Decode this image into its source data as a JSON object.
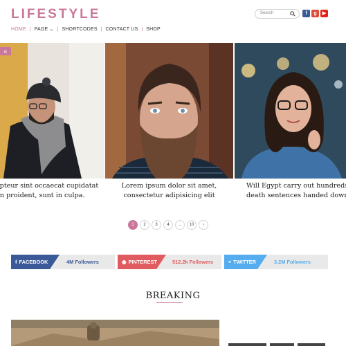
{
  "header": {
    "logo": "LIFESTYLE",
    "search_placeholder": "Search",
    "social_icons": [
      "facebook-icon",
      "google-plus-icon",
      "youtube-icon"
    ],
    "social_glyphs": [
      "f",
      "g",
      "▶"
    ]
  },
  "nav": {
    "items": [
      "HOME",
      "PAGE",
      "SHORTCODES",
      "CONTACT US",
      "SHOP"
    ]
  },
  "slider": {
    "prev_arrow": "«",
    "cards": [
      {
        "line1": "epteur sint occaecat cupidatat",
        "line2": "on proident, sunt in culpa."
      },
      {
        "line1": "Lorem ipsum dolor sit amet,",
        "line2": "consectetur adipisicing elit"
      },
      {
        "line1": "Will Egypt carry out hundreds o",
        "line2": "death sentences handed down?"
      }
    ]
  },
  "pagination": {
    "pages": [
      "1",
      "2",
      "3",
      "4",
      "...",
      "10",
      "›"
    ],
    "active": "1"
  },
  "social_counters": [
    {
      "network": "FACEBOOK",
      "count": "4M Followers",
      "color": "#3b5998"
    },
    {
      "network": "PINTEREST",
      "count": "512.2k Followers",
      "color": "#e05b5f"
    },
    {
      "network": "TWITTER",
      "count": "3.2M Followers",
      "color": "#55acee"
    }
  ],
  "breaking": {
    "title": "BREAKING"
  },
  "colors": {
    "accent": "#c9779a",
    "facebook": "#3b5998",
    "pinterest": "#e05b5f",
    "twitter": "#55acee"
  }
}
